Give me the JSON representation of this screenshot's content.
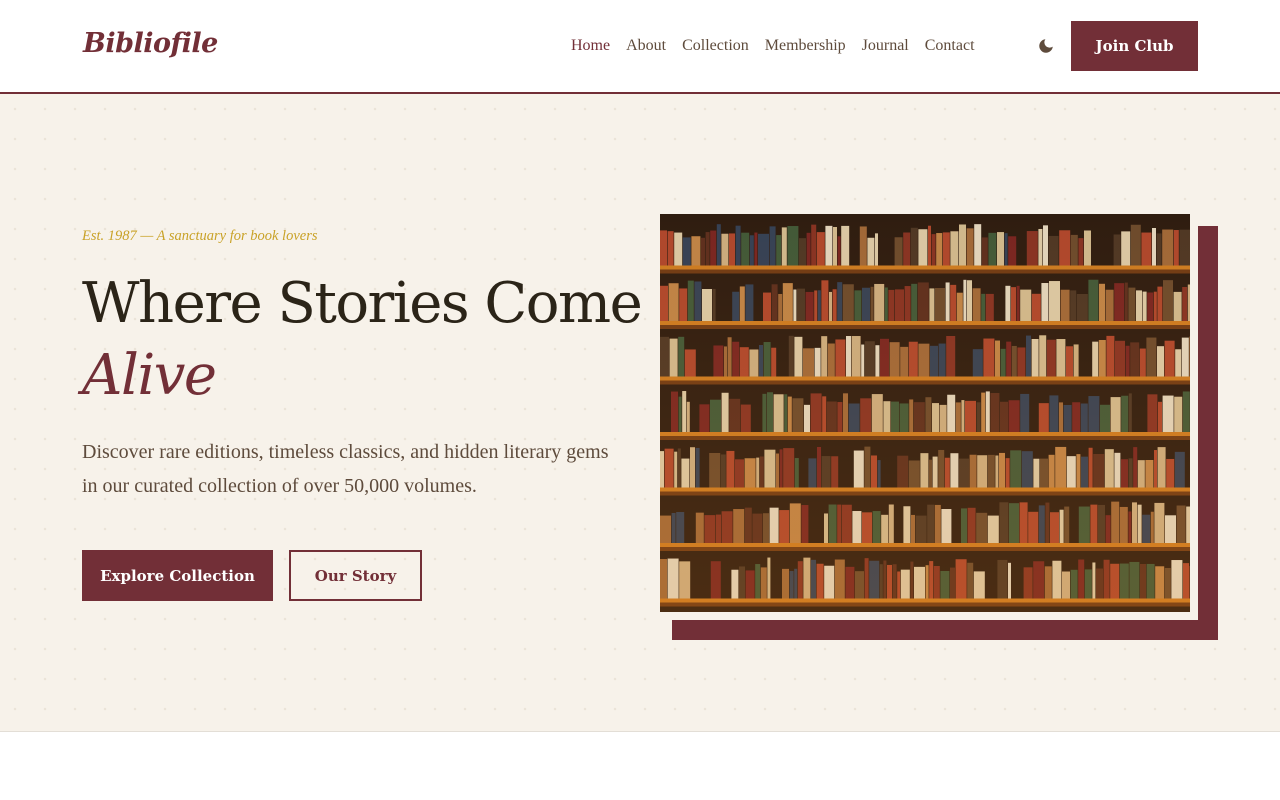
{
  "brand": {
    "name": "Bibliofile"
  },
  "nav": {
    "items": [
      {
        "label": "Home",
        "active": true
      },
      {
        "label": "About",
        "active": false
      },
      {
        "label": "Collection",
        "active": false
      },
      {
        "label": "Membership",
        "active": false
      },
      {
        "label": "Journal",
        "active": false
      },
      {
        "label": "Contact",
        "active": false
      }
    ],
    "theme_toggle_icon": "moon-icon",
    "cta_label": "Join Club"
  },
  "hero": {
    "tagline": "Est. 1987 — A sanctuary for book lovers",
    "headline": "Where Stories Come",
    "headline_accent": "Alive",
    "description": "Discover rare editions, timeless classics, and hidden literary gems in our curated collection of over 50,000 volumes.",
    "primary_button": "Explore Collection",
    "secondary_button": "Our Story",
    "image_subject": "library bookshelves"
  },
  "colors": {
    "brand": "#722f37",
    "gold": "#c9a227",
    "hero_background": "#f7f2ea",
    "text_dark": "#2b2418",
    "text_muted": "#5e4b3c"
  }
}
